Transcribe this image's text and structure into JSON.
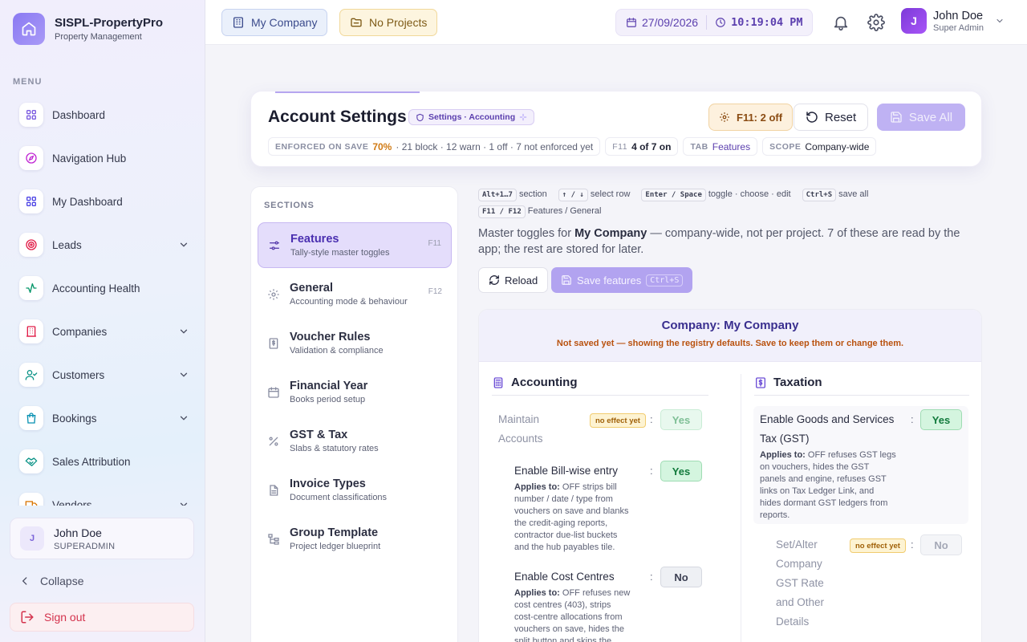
{
  "app": {
    "name": "SISPL-PropertyPro",
    "subtitle": "Property Management"
  },
  "sidebar": {
    "menu_label": "MENU",
    "items": [
      {
        "label": "Dashboard",
        "icon": "grid-icon",
        "color": "#7c5ce0",
        "expandable": false
      },
      {
        "label": "Navigation Hub",
        "icon": "compass-icon",
        "color": "#c026d3",
        "expandable": false
      },
      {
        "label": "My Dashboard",
        "icon": "grid-icon",
        "color": "#4f46e5",
        "expandable": false
      },
      {
        "label": "Leads",
        "icon": "target-icon",
        "color": "#e11d48",
        "expandable": true
      },
      {
        "label": "Accounting Health",
        "icon": "activity-icon",
        "color": "#059669",
        "expandable": false
      },
      {
        "label": "Companies",
        "icon": "building-icon",
        "color": "#e11d48",
        "expandable": true
      },
      {
        "label": "Customers",
        "icon": "user-check-icon",
        "color": "#0d9488",
        "expandable": true
      },
      {
        "label": "Bookings",
        "icon": "bag-icon",
        "color": "#0891b2",
        "expandable": true
      },
      {
        "label": "Sales Attribution",
        "icon": "handshake-icon",
        "color": "#0d9488",
        "expandable": false
      },
      {
        "label": "Vendors",
        "icon": "truck-icon",
        "color": "#d97706",
        "expandable": true
      }
    ],
    "user": {
      "initial": "J",
      "name": "John Doe",
      "role": "SUPERADMIN"
    },
    "collapse_label": "Collapse",
    "signout_label": "Sign out"
  },
  "topbar": {
    "company": "My Company",
    "projects": "No Projects",
    "date": "27/09/2026",
    "time": "10:19:04 PM",
    "user": {
      "initial": "J",
      "name": "John Doe",
      "role": "Super Admin"
    }
  },
  "header": {
    "title": "Account Settings",
    "tag": "Settings · Accounting",
    "f11_button": "F11: 2 off",
    "reset_button": "Reset",
    "save_all_button": "Save All",
    "enforced_label": "ENFORCED ON SAVE",
    "enforced_pct": "70%",
    "enforced_detail": "· 21 block · 12 warn · 1 off · 7 not enforced yet",
    "f11_key": "F11",
    "f11_value": "4 of 7 on",
    "tab_key": "TAB",
    "tab_value": "Features",
    "scope_key": "SCOPE",
    "scope_value": "Company-wide"
  },
  "sections": {
    "label": "SECTIONS",
    "items": [
      {
        "name": "Features",
        "sub": "Tally-style master toggles",
        "key": "F11",
        "icon": "sliders-icon",
        "active": true
      },
      {
        "name": "General",
        "sub": "Accounting mode & behaviour",
        "key": "F12",
        "icon": "gear-icon",
        "active": false
      },
      {
        "name": "Voucher Rules",
        "sub": "Validation & compliance",
        "key": "",
        "icon": "receipt-icon",
        "active": false
      },
      {
        "name": "Financial Year",
        "sub": "Books period setup",
        "key": "",
        "icon": "calendar-icon",
        "active": false
      },
      {
        "name": "GST & Tax",
        "sub": "Slabs & statutory rates",
        "key": "",
        "icon": "percent-icon",
        "active": false
      },
      {
        "name": "Invoice Types",
        "sub": "Document classifications",
        "key": "",
        "icon": "document-icon",
        "active": false
      },
      {
        "name": "Group Template",
        "sub": "Project ledger blueprint",
        "key": "",
        "icon": "tree-icon",
        "active": false
      }
    ]
  },
  "shortcuts": [
    {
      "key": "Alt+1…7",
      "text": "section"
    },
    {
      "key": "↑ / ↓",
      "text": "select row"
    },
    {
      "key": "Enter / Space",
      "text": "toggle · choose · edit"
    },
    {
      "key": "Ctrl+S",
      "text": "save all"
    },
    {
      "key": "F11 / F12",
      "text": "Features / General"
    }
  ],
  "description": {
    "pre": "Master toggles for ",
    "company": "My Company",
    "post": " — company-wide, not per project. 7 of these are read by the app; the rest are stored for later."
  },
  "actions": {
    "reload": "Reload",
    "save_features": "Save features",
    "save_features_kbd": "Ctrl+S"
  },
  "company_card": {
    "title": "Company: My Company",
    "warning": "Not saved yet — showing the registry defaults. Save to keep them or change them."
  },
  "accounting": {
    "title": "Accounting",
    "rows": [
      {
        "label_lines": [
          "Maintain",
          "Accounts"
        ],
        "badge": "no effect yet",
        "value": "Yes"
      },
      {
        "label_lines": [
          "Enable Bill-wise entry"
        ],
        "applies_label": "Applies to:",
        "applies_lines": [
          " OFF strips bill",
          "number / date / type from",
          "vouchers on save and blanks",
          "the credit-aging reports,",
          "contractor due-list buckets",
          "and the hub payables tile."
        ],
        "value": "Yes"
      },
      {
        "label_lines": [
          "Enable Cost Centres"
        ],
        "applies_label": "Applies to:",
        "applies_lines": [
          " OFF refuses new",
          "cost centres (403), strips",
          "cost-centre allocations from",
          "vouchers on save, hides the",
          "split button and skips the"
        ],
        "value": "No"
      }
    ]
  },
  "taxation": {
    "title": "Taxation",
    "rows": [
      {
        "label_lines": [
          "Enable Goods and Services",
          "Tax (GST)"
        ],
        "applies_label": "Applies to:",
        "applies_lines": [
          " OFF refuses GST legs",
          "on vouchers, hides the GST",
          "panels and engine, refuses GST",
          "links on Tax Ledger Link, and",
          "hides dormant GST ledgers from",
          "reports."
        ],
        "value": "Yes"
      },
      {
        "label_lines": [
          "Set/Alter",
          "Company",
          "GST Rate",
          "and Other",
          "Details"
        ],
        "badge": "no effect yet",
        "value": "No"
      }
    ]
  },
  "colors": {
    "accent": "#7c5ce0",
    "success": "#127a3c",
    "warning": "#b9520f",
    "danger": "#d4334d"
  }
}
